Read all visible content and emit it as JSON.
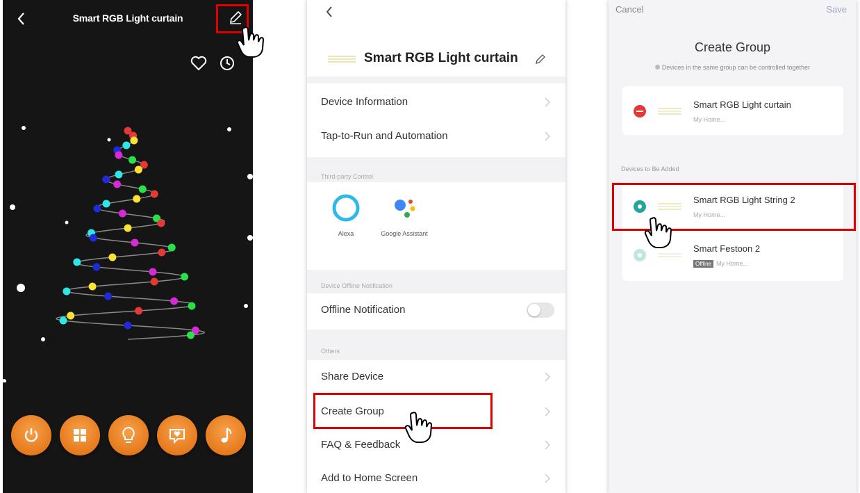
{
  "screen1": {
    "title": "Smart RGB Light curtain",
    "icons": [
      "back-icon",
      "pencil-icon",
      "heart-icon",
      "clock-icon"
    ],
    "controls": [
      {
        "name": "power",
        "icon": "power-icon"
      },
      {
        "name": "scenes",
        "icon": "grid-icon"
      },
      {
        "name": "light",
        "icon": "bulb-icon"
      },
      {
        "name": "mode",
        "icon": "heart-chat-icon"
      },
      {
        "name": "music",
        "icon": "music-note-icon"
      }
    ],
    "accent": "#e67a1c"
  },
  "screen2": {
    "device_name": "Smart RGB Light curtain",
    "rows": {
      "device_info": "Device Information",
      "tap_to_run": "Tap-to-Run and Automation",
      "offline_notification": "Offline Notification",
      "share_device": "Share Device",
      "create_group": "Create Group",
      "faq": "FAQ & Feedback",
      "add_home": "Add to Home Screen"
    },
    "sections": {
      "third_party": "Third-party Control",
      "offline": "Device Offline Notification",
      "others": "Others"
    },
    "third_party": [
      {
        "label": "Alexa"
      },
      {
        "label": "Google Assistant"
      }
    ],
    "offline_toggle": false
  },
  "screen3": {
    "cancel": "Cancel",
    "save": "Save",
    "title": "Create Group",
    "subtitle": "Devices in the same group can be controlled together",
    "added_section": "",
    "to_add_section": "Devices to Be Added",
    "group_devices": [
      {
        "name": "Smart RGB Light curtain",
        "home": "My Home..."
      }
    ],
    "candidates": [
      {
        "name": "Smart RGB Light String 2",
        "home": "My Home..."
      },
      {
        "name": "Smart Festoon 2",
        "home": "My Home...",
        "badge": "Offline"
      }
    ],
    "colors": {
      "remove": "#e53935",
      "add": "#26a69a",
      "add_disabled": "#bfe6e1"
    }
  }
}
